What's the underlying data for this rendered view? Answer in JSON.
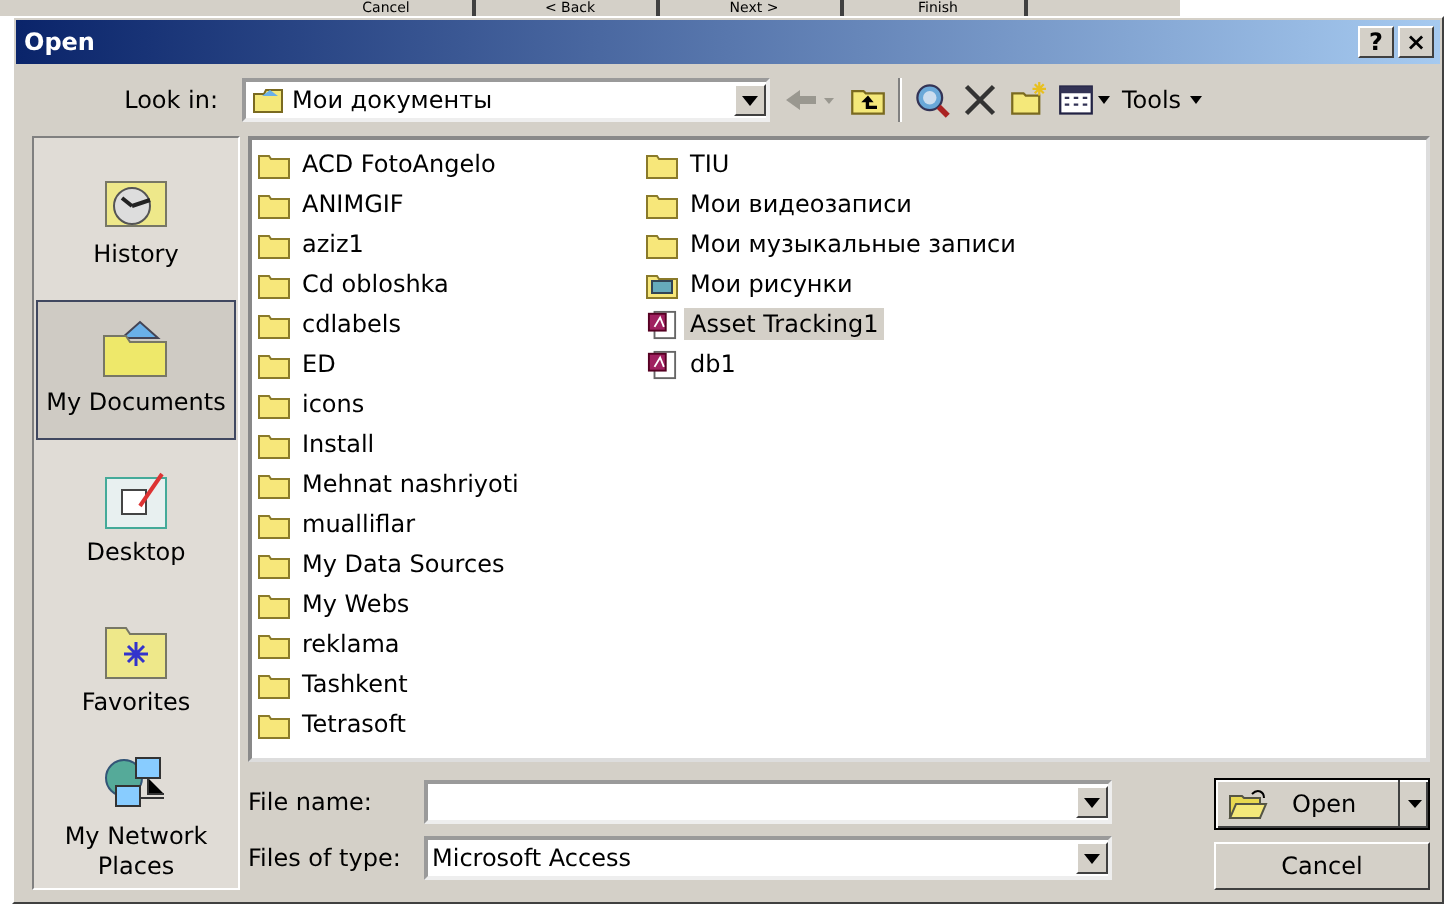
{
  "background_window": {
    "buttons": [
      "Cancel",
      "< Back",
      "Next >",
      "Finish"
    ]
  },
  "window": {
    "title": "Open",
    "help": "?",
    "close": "×"
  },
  "toolbar": {
    "look_in_label": "Look in:",
    "look_in_value": "Мои документы",
    "tools": "Tools"
  },
  "places": [
    {
      "label": "History",
      "kind": "history",
      "selected": false
    },
    {
      "label": "My Documents",
      "kind": "documents",
      "selected": true
    },
    {
      "label": "Desktop",
      "kind": "desktop",
      "selected": false
    },
    {
      "label": "Favorites",
      "kind": "favorites",
      "selected": false
    },
    {
      "label": "My Network Places",
      "kind": "network",
      "selected": false
    }
  ],
  "files": [
    {
      "name": "ACD FotoAngelo",
      "kind": "folder",
      "selected": false
    },
    {
      "name": "ANIMGIF",
      "kind": "folder",
      "selected": false
    },
    {
      "name": "aziz1",
      "kind": "folder",
      "selected": false
    },
    {
      "name": "Cd obloshka",
      "kind": "folder",
      "selected": false
    },
    {
      "name": "cdlabels",
      "kind": "folder",
      "selected": false
    },
    {
      "name": "ED",
      "kind": "folder",
      "selected": false
    },
    {
      "name": "icons",
      "kind": "folder",
      "selected": false
    },
    {
      "name": "Install",
      "kind": "folder",
      "selected": false
    },
    {
      "name": "Mehnat nashriyoti",
      "kind": "folder",
      "selected": false
    },
    {
      "name": "mualliflar",
      "kind": "folder",
      "selected": false
    },
    {
      "name": "My Data Sources",
      "kind": "folder",
      "selected": false
    },
    {
      "name": "My Webs",
      "kind": "folder",
      "selected": false
    },
    {
      "name": "reklama",
      "kind": "folder",
      "selected": false
    },
    {
      "name": "Tashkent",
      "kind": "folder",
      "selected": false
    },
    {
      "name": "Tetrasoft",
      "kind": "folder",
      "selected": false
    },
    {
      "name": "TIU",
      "kind": "folder",
      "selected": false
    },
    {
      "name": "Мои видеозаписи",
      "kind": "folder",
      "selected": false
    },
    {
      "name": "Мои музыкальные записи",
      "kind": "folder",
      "selected": false
    },
    {
      "name": "Мои рисунки",
      "kind": "pictures",
      "selected": false
    },
    {
      "name": "Asset Tracking1",
      "kind": "database",
      "selected": true
    },
    {
      "name": "db1",
      "kind": "database",
      "selected": false
    }
  ],
  "file_name": {
    "label": "File name:"
  },
  "file_type": {
    "label": "Files of type:",
    "value": "Microsoft Access"
  },
  "buttons": {
    "open": "Open",
    "cancel": "Cancel"
  }
}
